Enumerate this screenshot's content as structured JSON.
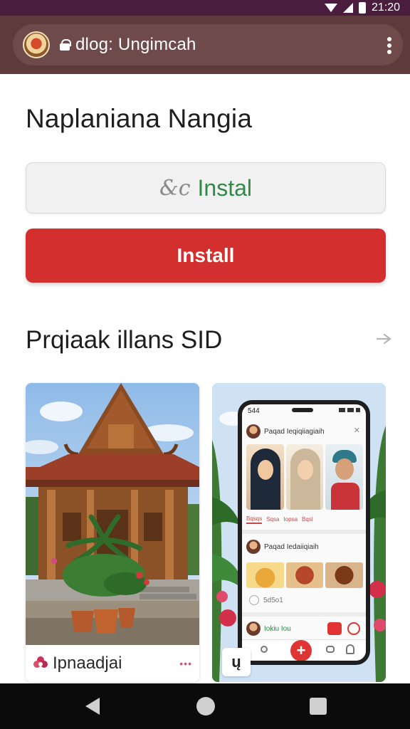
{
  "status_bar": {
    "time": "21:20"
  },
  "browser": {
    "url": "dlog: Ungimcah"
  },
  "page": {
    "title": "Naplaniana Nangia",
    "secondary_button": {
      "symbol": "&c",
      "label": "Instal"
    },
    "primary_button": {
      "label": "Install"
    },
    "section_title": "Prqiaak illans SID"
  },
  "cards": [
    {
      "caption": "Ipnaadjai",
      "more": "•••"
    },
    {
      "phone": {
        "time": "544",
        "post_title": "Paqad Ieqiqiiagiaih",
        "tabs": [
          "Bqsqs",
          "Sqsa",
          "Iopsa",
          "Bqsl"
        ],
        "post2_title": "Paqad Iedaiiqiaih",
        "count": "5d5o1",
        "post3_title": "Iokiu Iou",
        "plus": "+"
      },
      "chip": "ų"
    }
  ],
  "colors": {
    "status_bar": "#4a1d3e",
    "browser_bar": "#5e3a3c",
    "install_red": "#d32f2f",
    "instal_green": "#2f8a47"
  },
  "icons": {
    "status": [
      "wifi-icon",
      "signal-icon",
      "battery-icon"
    ],
    "browser": [
      "site-logo-icon",
      "lock-icon",
      "more-vert-icon"
    ],
    "section": "arrow-right-icon",
    "nav": [
      "back-icon",
      "home-icon",
      "recents-icon"
    ]
  }
}
